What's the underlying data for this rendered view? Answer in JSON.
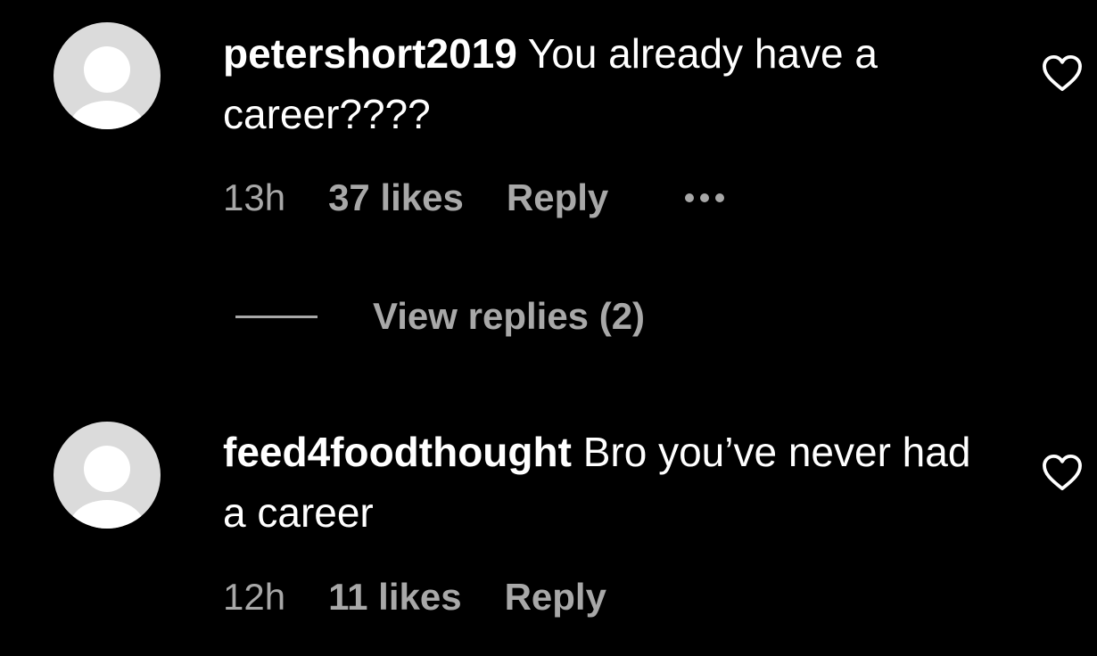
{
  "comments": [
    {
      "username": "petershort2019",
      "text": "You already have a career????",
      "time": "13h",
      "likes": "37 likes",
      "reply_label": "Reply",
      "more_icon": "more-options-icon",
      "like_icon": "heart-outline-icon",
      "view_replies_label": "View replies (2)"
    },
    {
      "username": "feed4foodthought",
      "text": "Bro you’ve never had a career",
      "time": "12h",
      "likes": "11 likes",
      "reply_label": "Reply",
      "like_icon": "heart-outline-icon"
    }
  ],
  "colors": {
    "background": "#000000",
    "primary_text": "#ffffff",
    "secondary_text": "#a8a8a8",
    "avatar_bg": "#dbdbdb"
  }
}
